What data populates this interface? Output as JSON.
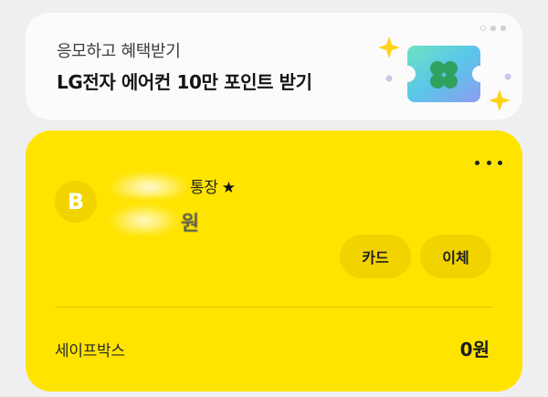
{
  "promo": {
    "subtitle": "응모하고 혜택받기",
    "title": "LG전자 에어컨 10만 포인트 받기",
    "page_indicator": {
      "count": 3,
      "active_index": 0
    },
    "illustration": "clover-ticket-icon"
  },
  "account": {
    "bank_logo_letter": "B",
    "name_suffix": "통장",
    "favorite_icon": "★",
    "balance_unit": "원",
    "more_icon": "more-horizontal-icon",
    "buttons": {
      "card": "카드",
      "transfer": "이체"
    },
    "safebox": {
      "label": "세이프박스",
      "amount": "0원"
    }
  },
  "colors": {
    "background": "#efeff1",
    "card_yellow": "#ffe400",
    "button_yellow": "#f1d300",
    "promo_bg": "#fbfbfc"
  }
}
